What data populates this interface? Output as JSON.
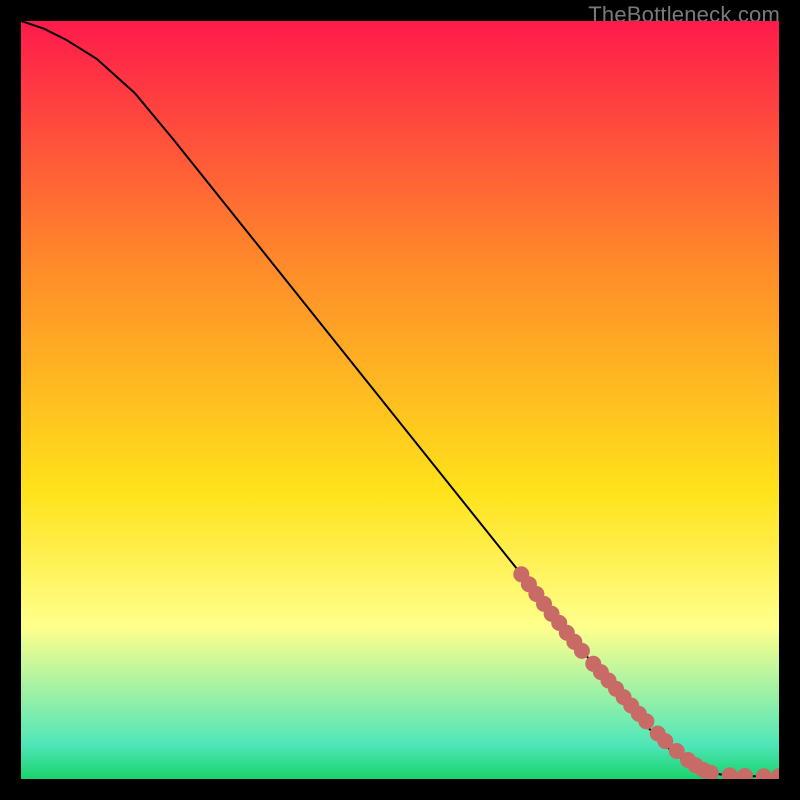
{
  "watermark": "TheBottleneck.com",
  "colors": {
    "top": "#ff1a4b",
    "orange": "#ff8a2a",
    "yellow": "#ffe21a",
    "pale": "#ffff8c",
    "cyan": "#4fe6b9",
    "green": "#19d36a",
    "curve": "#000000",
    "dot": "#c86b66",
    "bg": "#000000"
  },
  "chart_data": {
    "type": "line",
    "title": "",
    "xlabel": "",
    "ylabel": "",
    "xlim": [
      0,
      100
    ],
    "ylim": [
      0,
      100
    ],
    "series": [
      {
        "name": "bottleneck-curve",
        "x": [
          0,
          3,
          6,
          10,
          15,
          20,
          30,
          40,
          50,
          60,
          66,
          70,
          74,
          78,
          82,
          86,
          89,
          91,
          93,
          94.5,
          96,
          97.5,
          100
        ],
        "values": [
          100,
          99,
          97.5,
          95,
          90.5,
          84.5,
          72,
          59.5,
          47,
          34.5,
          27,
          22,
          17,
          12,
          7.5,
          3.5,
          1.5,
          0.8,
          0.5,
          0.4,
          0.35,
          0.35,
          0.35
        ]
      }
    ],
    "markers": {
      "name": "highlighted-points",
      "x": [
        66,
        67,
        68,
        69,
        70,
        71,
        72,
        73,
        74,
        75.5,
        76.5,
        77.5,
        78.5,
        79.5,
        80.5,
        81.5,
        82.5,
        84,
        85,
        86.5,
        88,
        89,
        90,
        91,
        93.5,
        95.5,
        98,
        100
      ],
      "values": [
        27,
        25.7,
        24.4,
        23.1,
        21.8,
        20.6,
        19.3,
        18.1,
        16.9,
        15.2,
        14.1,
        13.0,
        11.9,
        10.8,
        9.7,
        8.6,
        7.6,
        6.0,
        5.0,
        3.7,
        2.5,
        1.8,
        1.2,
        0.8,
        0.5,
        0.4,
        0.35,
        0.35
      ]
    },
    "gradient_stops": [
      {
        "pos": 0.0,
        "ref": "top"
      },
      {
        "pos": 0.32,
        "ref": "orange"
      },
      {
        "pos": 0.62,
        "ref": "yellow"
      },
      {
        "pos": 0.8,
        "ref": "pale"
      },
      {
        "pos": 0.955,
        "ref": "cyan"
      },
      {
        "pos": 1.0,
        "ref": "green"
      }
    ]
  }
}
